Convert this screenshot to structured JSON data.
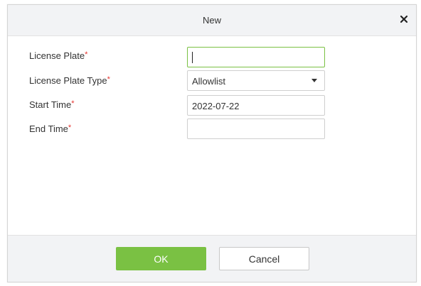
{
  "dialog": {
    "title": "New",
    "close_icon": "close-icon"
  },
  "form": {
    "required_mark": "*",
    "license_plate": {
      "label": "License Plate",
      "value": ""
    },
    "license_plate_type": {
      "label": "License Plate Type",
      "selected": "Allowlist"
    },
    "start_time": {
      "label": "Start Time",
      "value": "2022-07-22"
    },
    "end_time": {
      "label": "End Time",
      "value": ""
    }
  },
  "footer": {
    "ok_label": "OK",
    "cancel_label": "Cancel"
  },
  "colors": {
    "accent": "#7ac143",
    "required": "#e5322d",
    "header_bg": "#f2f3f5"
  }
}
